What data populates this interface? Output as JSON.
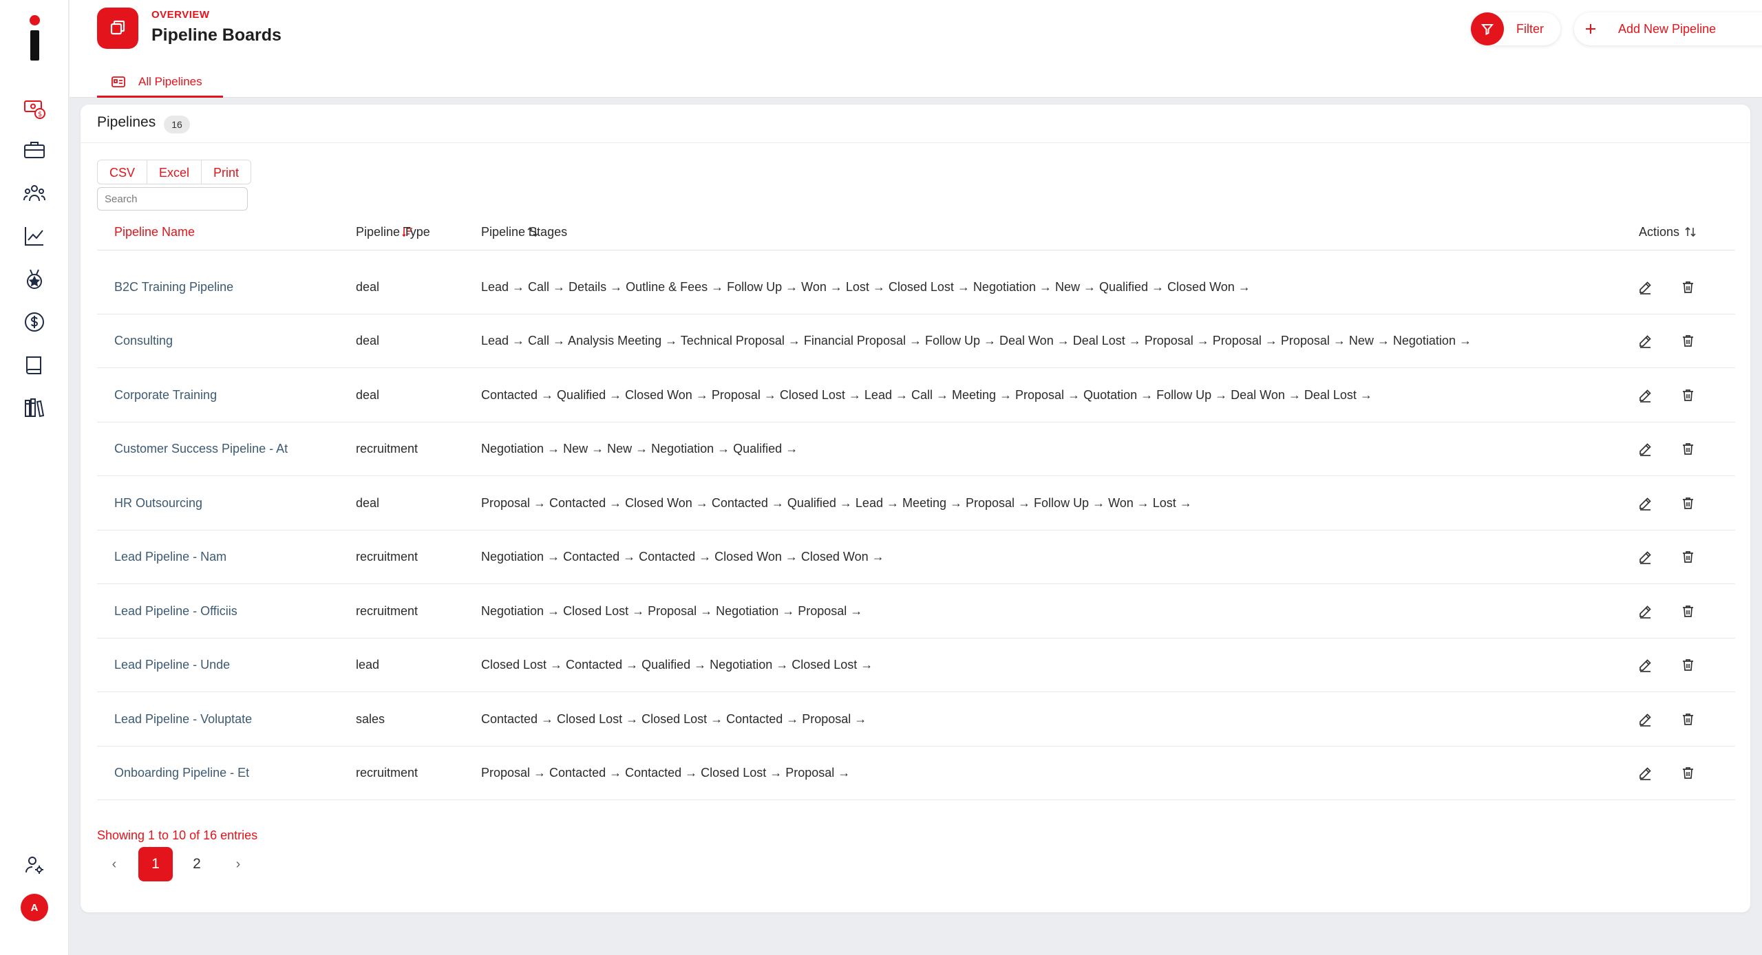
{
  "header": {
    "overline": "OVERVIEW",
    "title": "Pipeline Boards",
    "filter_label": "Filter",
    "add_label": "Add New Pipeline",
    "tab_label": "All Pipelines"
  },
  "sidebar": {
    "items": [
      {
        "icon": "money-icon"
      },
      {
        "icon": "briefcase-icon"
      },
      {
        "icon": "users-icon"
      },
      {
        "icon": "chart-line-icon"
      },
      {
        "icon": "medal-icon"
      },
      {
        "icon": "dollar-circle-icon"
      },
      {
        "icon": "book-icon"
      },
      {
        "icon": "library-icon"
      }
    ],
    "user_icon": "user-settings-icon",
    "avatar_initial": "A"
  },
  "card": {
    "title": "Pipelines",
    "count": "16",
    "export_buttons": [
      "CSV",
      "Excel",
      "Print"
    ],
    "search_placeholder": "Search"
  },
  "table": {
    "columns": {
      "name": "Pipeline Name",
      "type": "Pipeline Type",
      "stages": "Pipeline Stages",
      "actions": "Actions"
    },
    "rows": [
      {
        "name": "B2C Training Pipeline",
        "type": "deal",
        "stages": "Lead → Call → Details → Outline & Fees → Follow Up → Won → Lost → Closed Lost → Negotiation → New → Qualified → Closed Won →"
      },
      {
        "name": "Consulting",
        "type": "deal",
        "stages": "Lead → Call → Analysis Meeting → Technical Proposal → Financial Proposal → Follow Up → Deal Won → Deal Lost → Proposal → Proposal → Proposal → New → Negotiation →"
      },
      {
        "name": "Corporate Training",
        "type": "deal",
        "stages": "Contacted → Qualified → Closed Won → Proposal → Closed Lost → Lead → Call → Meeting → Proposal → Quotation → Follow Up → Deal Won → Deal Lost →"
      },
      {
        "name": "Customer Success Pipeline - At",
        "type": "recruitment",
        "stages": "Negotiation → New → New → Negotiation → Qualified →"
      },
      {
        "name": "HR Outsourcing",
        "type": "deal",
        "stages": "Proposal → Contacted → Closed Won → Contacted → Qualified → Lead → Meeting → Proposal → Follow Up → Won → Lost →"
      },
      {
        "name": "Lead Pipeline - Nam",
        "type": "recruitment",
        "stages": "Negotiation → Contacted → Contacted → Closed Won → Closed Won →"
      },
      {
        "name": "Lead Pipeline - Officiis",
        "type": "recruitment",
        "stages": "Negotiation → Closed Lost → Proposal → Negotiation → Proposal →"
      },
      {
        "name": "Lead Pipeline - Unde",
        "type": "lead",
        "stages": "Closed Lost → Contacted → Qualified → Negotiation → Closed Lost →"
      },
      {
        "name": "Lead Pipeline - Voluptate",
        "type": "sales",
        "stages": "Contacted → Closed Lost → Closed Lost → Contacted → Proposal →"
      },
      {
        "name": "Onboarding Pipeline - Et",
        "type": "recruitment",
        "stages": "Proposal → Contacted → Contacted → Closed Lost → Proposal →"
      }
    ],
    "row_actions": [
      "edit-icon",
      "trash-icon"
    ]
  },
  "pagination": {
    "showing_text": "Showing 1 to 10 of 16 entries",
    "prev": "‹",
    "pages": [
      "1",
      "2"
    ],
    "current": "1",
    "next": "›"
  },
  "colors": {
    "accent": "#e3141b",
    "link": "#3d5a73",
    "background": "#ecedf0"
  }
}
